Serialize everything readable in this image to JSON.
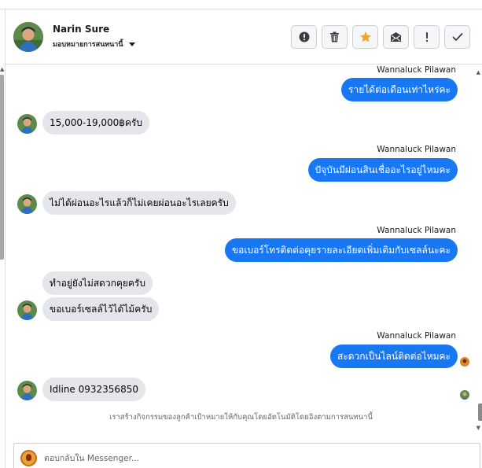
{
  "header": {
    "contact_name": "Narin Sure",
    "status_label": "มอบหมายการสนทนานี้",
    "actions": [
      {
        "name": "spam-button",
        "icon": "alert-circle-icon"
      },
      {
        "name": "delete-button",
        "icon": "trash-icon"
      },
      {
        "name": "star-button",
        "icon": "star-icon"
      },
      {
        "name": "mark-unread-button",
        "icon": "envelope-icon"
      },
      {
        "name": "follow-up-button",
        "icon": "exclamation-icon"
      },
      {
        "name": "mark-done-button",
        "icon": "checkmark-icon"
      }
    ]
  },
  "messages": [
    {
      "direction": "outgoing",
      "sender": "Wannaluck Pilawan",
      "text": "รายได้ต่อเดือนเท่าไหร่คะ"
    },
    {
      "direction": "incoming",
      "text": "15,000-19,000฿ครับ"
    },
    {
      "direction": "outgoing",
      "sender": "Wannaluck Pilawan",
      "text": "ปัจุบันมีผ่อนสินเชื่ออะไรอยู่ไหมคะ"
    },
    {
      "direction": "incoming",
      "text": "ไม่ได้ผ่อนอะไรแล้วก็ไม่เคยผ่อนอะไรเลยครับ"
    },
    {
      "direction": "outgoing",
      "sender": "Wannaluck Pilawan",
      "text": "ขอเบอร์โทรติดต่อคุยรายละเอียดเพิ่มเติมกับเซลล์นะคะ"
    },
    {
      "direction": "incoming",
      "text": "ทำอยู่ยังไม่สดวกคุยครับ"
    },
    {
      "direction": "incoming",
      "text": "ขอเบอร์เซลล์ไว้ได้ไม้ครับ"
    },
    {
      "direction": "outgoing",
      "sender": "Wannaluck Pilawan",
      "text": "สะดวกเป็นไลน์ติดต่อไหมคะ"
    },
    {
      "direction": "incoming",
      "text": "Idline 0932356850"
    }
  ],
  "notice": "เราสร้างกิจกรรมของลูกค้าเป้าหมายให้กับคุณโดยอัตโนมัติโดยอิงตามการสนทนานี้",
  "composer": {
    "placeholder": "ตอบกลับใน Messenger..."
  },
  "colors": {
    "outgoing_bubble": "#1877f2",
    "incoming_bubble": "#e4e6eb",
    "star_active": "#f5a623"
  }
}
